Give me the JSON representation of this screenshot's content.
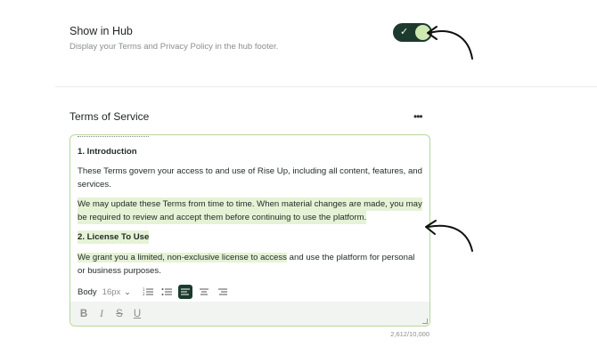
{
  "hub_setting": {
    "title": "Show in Hub",
    "description": "Display your Terms and Privacy Policy in the hub footer.",
    "enabled": true,
    "check_glyph": "✓"
  },
  "terms": {
    "title": "Terms of Service",
    "more_glyph": "•••",
    "lines": [
      {
        "text": "1. Introduction",
        "bold": true,
        "highlight": false
      },
      {
        "text": "These Terms govern your access to and use of Rise Up, including all content, features, and",
        "bold": false,
        "highlight": false
      },
      {
        "text": "services.",
        "bold": false,
        "highlight": false
      },
      {
        "text": "We may update these Terms from time to time. When material changes are made, you may",
        "bold": false,
        "highlight": true
      },
      {
        "text": "be required to review and accept them before continuing to use the platform.",
        "bold": false,
        "highlight": true
      },
      {
        "text": "2. License To Use",
        "bold": true,
        "highlight": true
      },
      {
        "text": "We grant you a limited, non-exclusive license to access",
        "bold": false,
        "highlight": true
      },
      {
        "text": " and use the platform for personal",
        "bold": false,
        "highlight": false
      },
      {
        "text": "or business purposes.",
        "bold": false,
        "highlight": false
      }
    ],
    "toolbar": {
      "style": "Body",
      "size": "16px",
      "chevron": "⌄",
      "active_align": "left"
    },
    "format_buttons": [
      "B",
      "I",
      "S",
      "U"
    ],
    "counter": "2,612/10,000"
  },
  "colors": {
    "toggle_bg": "#1d3a2e",
    "toggle_knob": "#cfe8b2",
    "highlight": "#e6f2d6",
    "editor_border": "#b8d79a"
  },
  "icons": [
    "check-icon",
    "more-icon",
    "chevron-down-icon",
    "ordered-list-icon",
    "bullet-list-icon",
    "align-left-icon",
    "align-center-icon",
    "align-right-icon",
    "bold-icon",
    "italic-icon",
    "strikethrough-icon",
    "underline-icon",
    "curved-arrow-icon"
  ]
}
